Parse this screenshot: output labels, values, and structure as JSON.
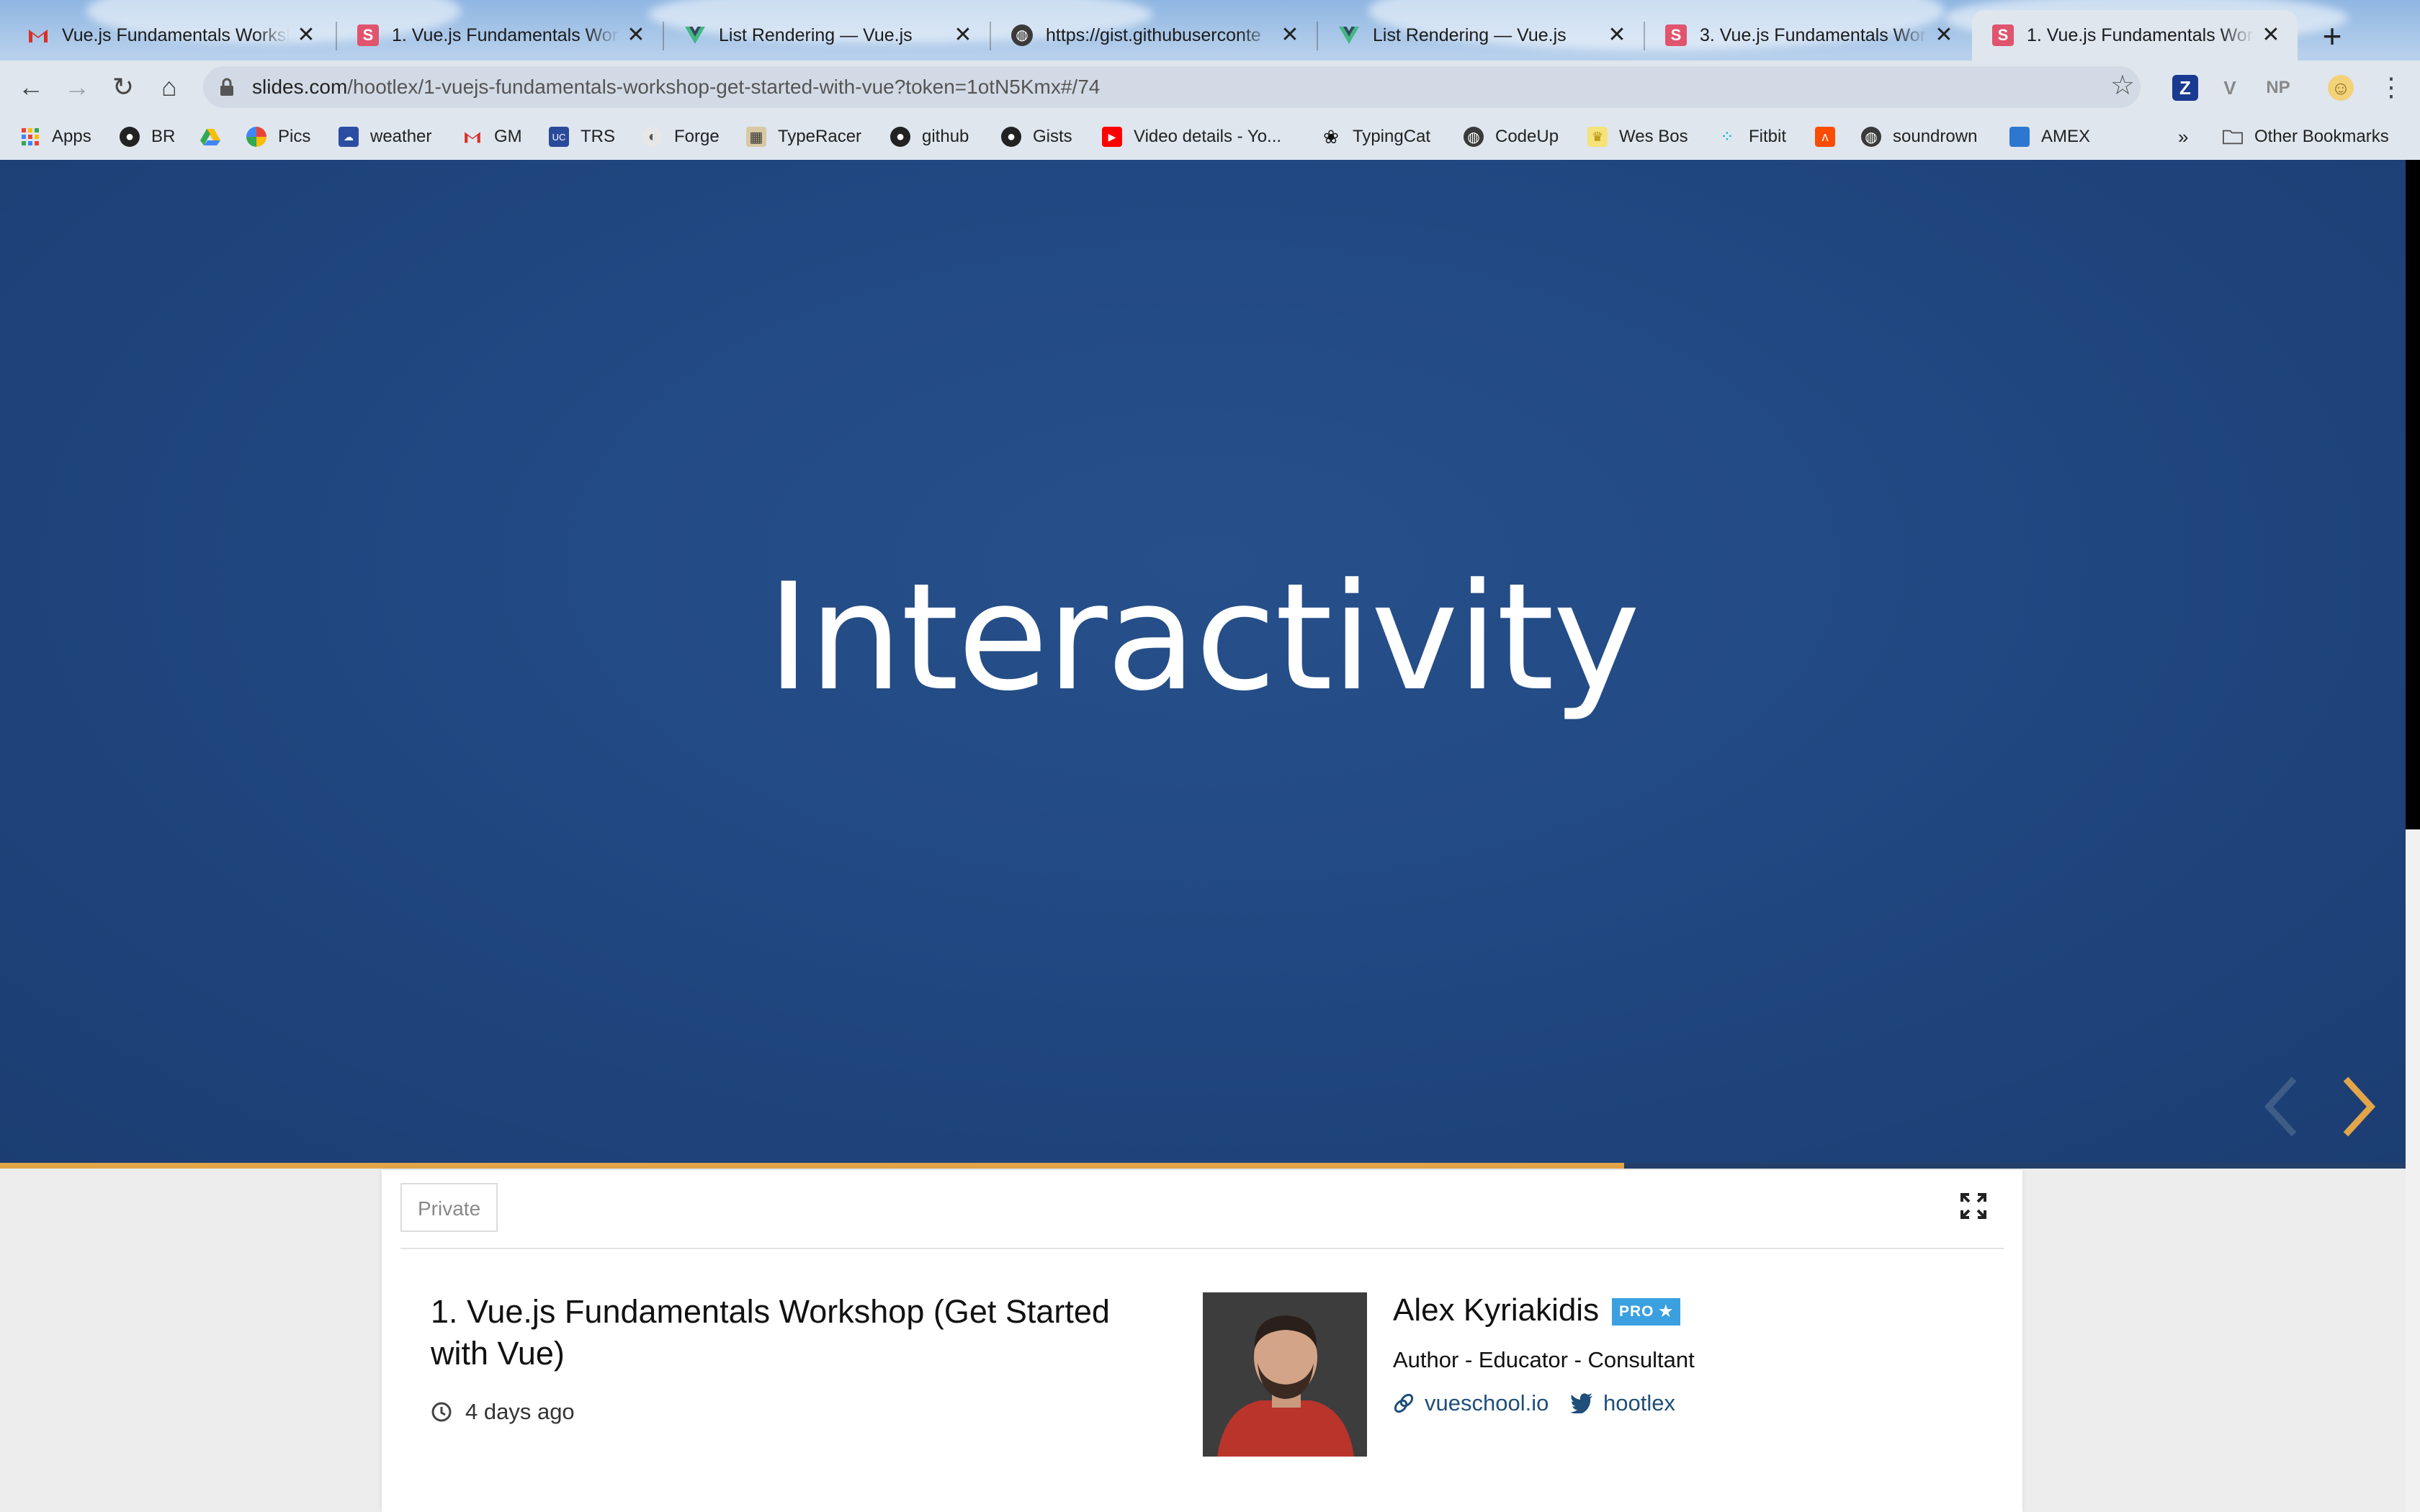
{
  "browser": {
    "tabs": [
      {
        "title": "Vue.js Fundamentals Worksh",
        "icon": "gmail-icon",
        "active": false
      },
      {
        "title": "1. Vue.js Fundamentals Work",
        "icon": "slides-icon",
        "active": false
      },
      {
        "title": "List Rendering — Vue.js",
        "icon": "vue-icon",
        "active": false
      },
      {
        "title": "https://gist.githubuserconte",
        "icon": "globe-icon",
        "active": false
      },
      {
        "title": "List Rendering — Vue.js",
        "icon": "vue-icon",
        "active": false
      },
      {
        "title": "3. Vue.js Fundamentals Work",
        "icon": "slides-icon",
        "active": false
      },
      {
        "title": "1. Vue.js Fundamentals Work",
        "icon": "slides-icon",
        "active": true
      }
    ],
    "new_tab_label": "+",
    "close_glyph": "✕",
    "url_host": "slides.com",
    "url_path": "/hootlex/1-vuejs-fundamentals-workshop-get-started-with-vue?token=1otN5Kmx#/74",
    "extensions": [
      "Z",
      "V",
      "NP",
      "☺"
    ],
    "bookmarks": [
      {
        "label": "Apps",
        "icon": "apps-grid-icon"
      },
      {
        "label": "BR",
        "icon": "github-icon"
      },
      {
        "label": "",
        "icon": "drive-icon"
      },
      {
        "label": "Pics",
        "icon": "photos-icon"
      },
      {
        "label": "weather",
        "icon": "weather-icon"
      },
      {
        "label": "GM",
        "icon": "gmail-icon"
      },
      {
        "label": "TRS",
        "icon": "trs-icon"
      },
      {
        "label": "Forge",
        "icon": "forge-icon"
      },
      {
        "label": "TypeRacer",
        "icon": "typeracer-icon"
      },
      {
        "label": "github",
        "icon": "github-icon"
      },
      {
        "label": "Gists",
        "icon": "github-icon"
      },
      {
        "label": "Video details - Yo...",
        "icon": "youtube-icon"
      },
      {
        "label": "TypingCat",
        "icon": "paw-icon"
      },
      {
        "label": "CodeUp",
        "icon": "globe-icon"
      },
      {
        "label": "Wes Bos",
        "icon": "crown-icon"
      },
      {
        "label": "Fitbit",
        "icon": "fitbit-icon"
      },
      {
        "label": "",
        "icon": "strava-icon"
      },
      {
        "label": "soundrown",
        "icon": "globe-icon"
      },
      {
        "label": "AMEX",
        "icon": "amex-icon"
      }
    ],
    "overflow_label": "»",
    "other_bookmarks": "Other Bookmarks"
  },
  "slide": {
    "title": "Interactivity",
    "background_color": "#214882",
    "progress_fraction": 0.675,
    "progress_color": "#e2a54a",
    "prev_arrow_icon": "chevron-left-icon",
    "next_arrow_icon": "chevron-right-icon"
  },
  "deck": {
    "visibility": "Private",
    "title": "1. Vue.js Fundamentals Workshop (Get Started with Vue)",
    "age": "4 days ago",
    "author": {
      "name": "Alex Kyriakidis",
      "badge": "PRO ★",
      "role": "Author - Educator - Consultant",
      "website": "vueschool.io",
      "twitter": "hootlex"
    }
  }
}
